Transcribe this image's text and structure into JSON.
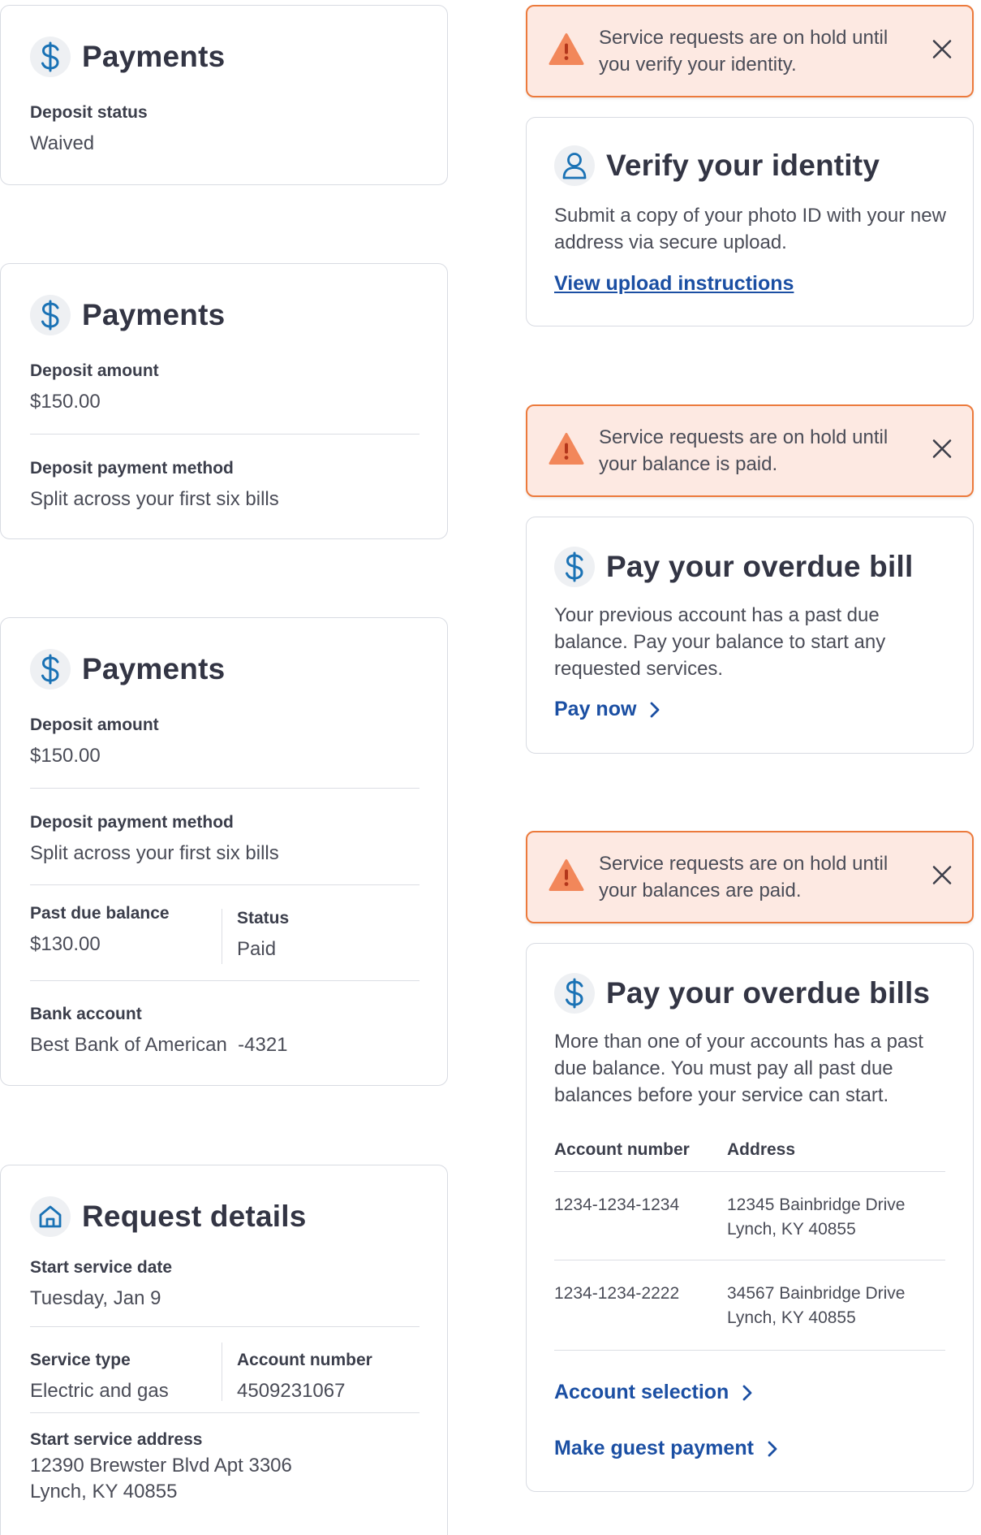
{
  "colors": {
    "accent_blue": "#1a72b5",
    "link_blue": "#1b4fa3",
    "alert_bg": "#fde9e2",
    "alert_border": "#ec7a3c",
    "warning_icon": "#f2875a"
  },
  "payments_card_1": {
    "title": "Payments",
    "icon": "dollar-icon",
    "deposit_status_label": "Deposit status",
    "deposit_status_value": "Waived"
  },
  "payments_card_2": {
    "title": "Payments",
    "icon": "dollar-icon",
    "deposit_amount_label": "Deposit amount",
    "deposit_amount_value": "$150.00",
    "deposit_method_label": "Deposit payment method",
    "deposit_method_value": "Split across your first six bills"
  },
  "payments_card_3": {
    "title": "Payments",
    "icon": "dollar-icon",
    "deposit_amount_label": "Deposit amount",
    "deposit_amount_value": "$150.00",
    "deposit_method_label": "Deposit payment method",
    "deposit_method_value": "Split across your first six bills",
    "past_due_label": "Past due balance",
    "past_due_value": "$130.00",
    "status_label": "Status",
    "status_value": "Paid",
    "bank_account_label": "Bank account",
    "bank_account_value": "Best Bank of American  -4321"
  },
  "request_details_card": {
    "title": "Request details",
    "icon": "home-icon",
    "start_date_label": "Start service date",
    "start_date_value": "Tuesday, Jan 9",
    "service_type_label": "Service type",
    "service_type_value": "Electric and gas",
    "account_number_label": "Account number",
    "account_number_value": "4509231067",
    "start_address_label": "Start service address",
    "start_address_line1": "12390 Brewster Blvd Apt 3306",
    "start_address_line2": "Lynch, KY 40855"
  },
  "alerts": [
    {
      "message": "Service requests are on hold until you verify your identity.",
      "icon": "warning-icon",
      "close_icon": "close-icon"
    },
    {
      "message": "Service requests are on hold until your balance is paid.",
      "icon": "warning-icon",
      "close_icon": "close-icon"
    },
    {
      "message": "Service requests are on hold until your balances are paid.",
      "icon": "warning-icon",
      "close_icon": "close-icon"
    }
  ],
  "verify_card": {
    "title": "Verify your identity",
    "icon": "person-icon",
    "body": "Submit a copy of your photo ID with your new address via secure upload.",
    "link": "View upload instructions"
  },
  "overdue_bill_card": {
    "title": "Pay your overdue bill",
    "icon": "dollar-icon",
    "body": "Your previous account has a past due balance. Pay your balance to start any requested services.",
    "link": "Pay now"
  },
  "overdue_bills_card": {
    "title": "Pay your overdue bills",
    "icon": "dollar-icon",
    "body": "More than one of your accounts has a past due balance. You must pay all past due balances before your service can start.",
    "table_headers": {
      "account": "Account number",
      "address": "Address"
    },
    "rows": [
      {
        "account": "1234-1234-1234",
        "address_line1": "12345 Bainbridge Drive",
        "address_line2": "Lynch, KY 40855"
      },
      {
        "account": "1234-1234-2222",
        "address_line1": "34567 Bainbridge Drive",
        "address_line2": "Lynch, KY 40855"
      }
    ],
    "link_account_selection": "Account selection",
    "link_guest_payment": "Make guest payment"
  }
}
